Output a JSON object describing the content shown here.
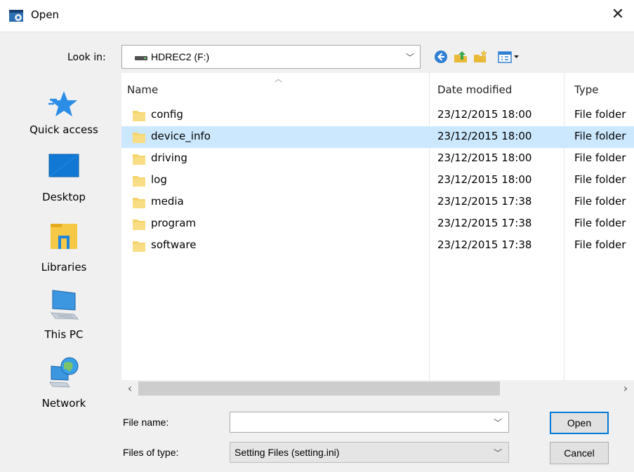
{
  "window": {
    "title": "Open",
    "close_glyph": "✕"
  },
  "lookin": {
    "label": "Look in:",
    "value": "HDREC2 (F:)"
  },
  "toolbar": {
    "icons": [
      "back-icon",
      "up-folder-icon",
      "new-folder-icon",
      "view-menu-icon"
    ]
  },
  "places": [
    {
      "label": "Quick access",
      "icon": "star-icon"
    },
    {
      "label": "Desktop",
      "icon": "desktop-icon"
    },
    {
      "label": "Libraries",
      "icon": "libraries-icon"
    },
    {
      "label": "This PC",
      "icon": "computer-icon"
    },
    {
      "label": "Network",
      "icon": "network-icon"
    }
  ],
  "columns": {
    "name": "Name",
    "date": "Date modified",
    "type": "Type"
  },
  "files": [
    {
      "name": "config",
      "date": "23/12/2015 18:00",
      "type": "File folder",
      "selected": false
    },
    {
      "name": "device_info",
      "date": "23/12/2015 18:00",
      "type": "File folder",
      "selected": true
    },
    {
      "name": "driving",
      "date": "23/12/2015 18:00",
      "type": "File folder",
      "selected": false
    },
    {
      "name": "log",
      "date": "23/12/2015 18:00",
      "type": "File folder",
      "selected": false
    },
    {
      "name": "media",
      "date": "23/12/2015 17:38",
      "type": "File folder",
      "selected": false
    },
    {
      "name": "program",
      "date": "23/12/2015 17:38",
      "type": "File folder",
      "selected": false
    },
    {
      "name": "software",
      "date": "23/12/2015 17:38",
      "type": "File folder",
      "selected": false
    }
  ],
  "filename": {
    "label": "File name:",
    "value": ""
  },
  "filetype": {
    "label": "Files of type:",
    "value": "Setting Files (setting.ini)"
  },
  "buttons": {
    "open": "Open",
    "cancel": "Cancel"
  },
  "colors": {
    "selection": "#cce8ff",
    "accent": "#0078d7",
    "folder": "#f6d46b"
  }
}
